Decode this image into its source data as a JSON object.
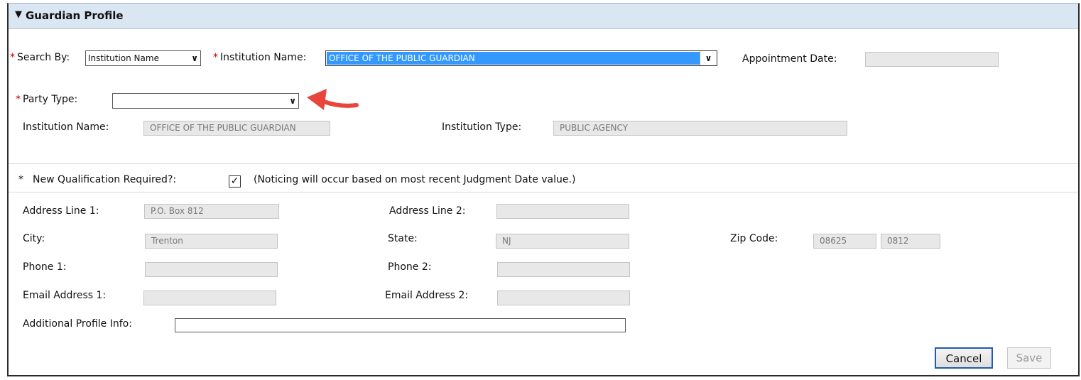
{
  "header": {
    "title": "Guardian Profile"
  },
  "search": {
    "label": "Search By:",
    "value": "Institution Name",
    "required_mark": "*"
  },
  "institution_select": {
    "label": "Institution Name:",
    "value": "OFFICE OF THE PUBLIC GUARDIAN",
    "required_mark": "*"
  },
  "appointment_date": {
    "label": "Appointment Date:",
    "value": ""
  },
  "party_type": {
    "label": "Party Type:",
    "value": "",
    "required_mark": "*"
  },
  "institution_name": {
    "label": "Institution Name:",
    "value": "OFFICE OF THE PUBLIC GUARDIAN"
  },
  "institution_type": {
    "label": "Institution Type:",
    "value": "PUBLIC AGENCY"
  },
  "qualification": {
    "required_mark": "*",
    "label": "New Qualification Required?:",
    "checked": true,
    "note": "(Noticing will occur based on most recent Judgment Date value.)"
  },
  "address": {
    "line1_label": "Address Line 1:",
    "line1_value": "P.O. Box 812",
    "line2_label": "Address Line 2:",
    "line2_value": "",
    "city_label": "City:",
    "city_value": "Trenton",
    "state_label": "State:",
    "state_value": "NJ",
    "zip_label": "Zip Code:",
    "zip_value": "08625",
    "zip_ext_value": "0812",
    "phone1_label": "Phone 1:",
    "phone1_value": "",
    "phone2_label": "Phone 2:",
    "phone2_value": "",
    "email1_label": "Email Address 1:",
    "email1_value": "",
    "email2_label": "Email Address 2:",
    "email2_value": "",
    "additional_label": "Additional Profile Info:",
    "additional_value": ""
  },
  "buttons": {
    "cancel": "Cancel",
    "save": "Save"
  },
  "colors": {
    "header_bg": "#dbe6f3",
    "required": "#c00000",
    "selection": "#3399ff",
    "arrow_annotation": "#e8453c"
  },
  "icons": {
    "collapse": "triangle-down-icon",
    "dropdown": "chevron-down-icon",
    "check": "checkmark-icon",
    "annotation": "red-arrow-icon"
  }
}
